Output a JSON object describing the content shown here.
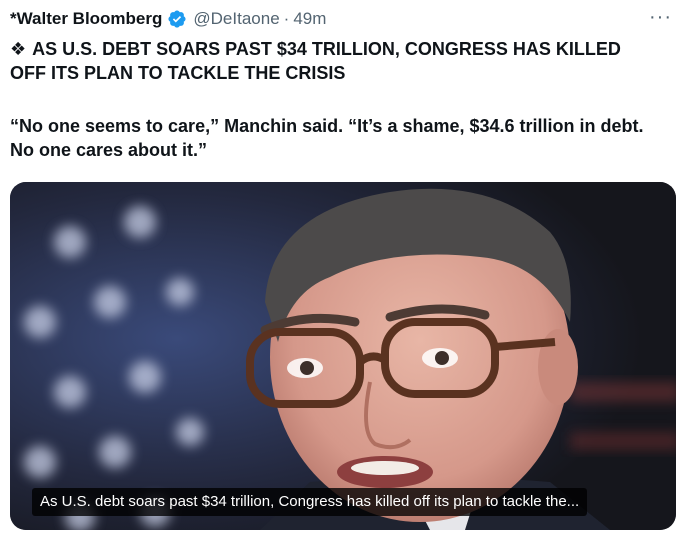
{
  "tweet": {
    "author_name": "*Walter Bloomberg",
    "handle": "@DeItaone",
    "separator": "·",
    "time": "49m",
    "more_label": "···",
    "headline_icon": "❖",
    "headline": "AS U.S. DEBT SOARS PAST $34 TRILLION, CONGRESS HAS KILLED OFF ITS PLAN TO TACKLE THE CRISIS",
    "quote": "“No one seems to care,” Manchin said. “It’s a shame, $34.6 trillion in debt. No one cares about it.”"
  },
  "media": {
    "caption": "As U.S. debt soars past $34 trillion, Congress has killed off its plan to tackle the..."
  },
  "colors": {
    "verified": "#1d9bf0",
    "muted_text": "#536471"
  },
  "icons": {
    "verified": "verified-badge-icon",
    "more": "more-options-icon"
  }
}
